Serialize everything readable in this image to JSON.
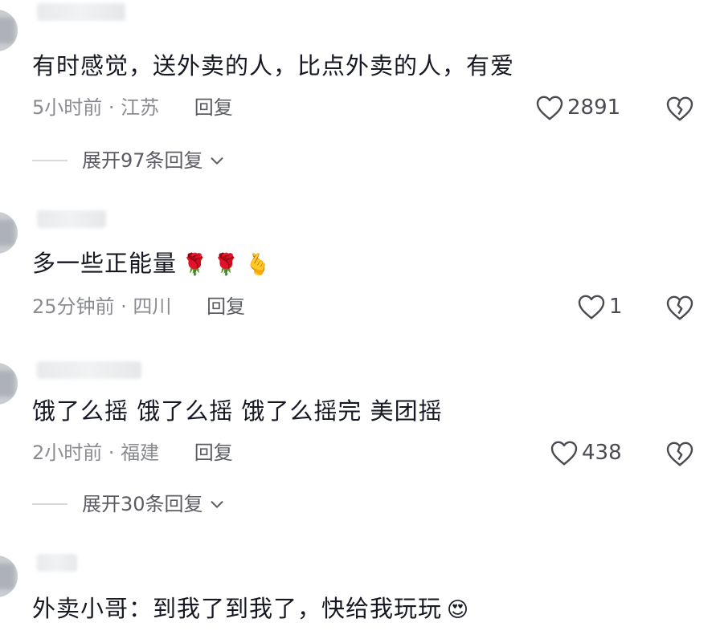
{
  "comments": [
    {
      "text": "有时感觉，送外卖的人，比点外卖的人，有爱",
      "time": "5小时前 · 江苏",
      "reply_label": "回复",
      "likes": "2891",
      "expand_label": "展开97条回复"
    },
    {
      "text": "多一些正能量",
      "emojis": [
        "🌹",
        "🌹",
        "🫰"
      ],
      "time": "25分钟前 · 四川",
      "reply_label": "回复",
      "likes": "1"
    },
    {
      "text": "饿了么摇  饿了么摇  饿了么摇完 美团摇",
      "time": "2小时前 · 福建",
      "reply_label": "回复",
      "likes": "438",
      "expand_label": "展开30条回复"
    },
    {
      "text": "外卖小哥：到我了到我了，快给我玩玩",
      "emojis": [
        "😍"
      ]
    }
  ],
  "icons": {
    "like": "heart-outline-icon",
    "dislike": "broken-heart-icon",
    "expand": "chevron-down-icon"
  },
  "colors": {
    "text": "#161823",
    "meta": "#8a8b91",
    "action": "#5b5c63"
  }
}
